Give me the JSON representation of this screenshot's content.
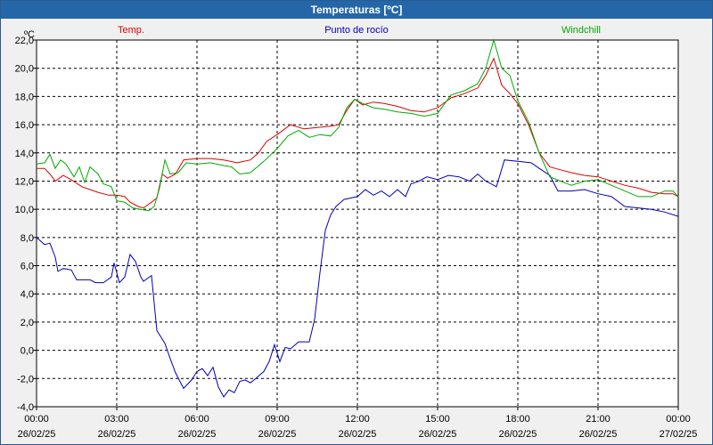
{
  "window": {
    "title": "Temperaturas [ºC]"
  },
  "chart_data": {
    "type": "line",
    "unit": "ºC",
    "ylim": [
      -4.0,
      22.0
    ],
    "ytick_step": 2,
    "ytick_labels": [
      "-4,0",
      "-2,0",
      "0,0",
      "2,0",
      "4,0",
      "6,0",
      "8,0",
      "10,0",
      "12,0",
      "14,0",
      "16,0",
      "18,0",
      "20,0",
      "22,0"
    ],
    "xlim": [
      0,
      24
    ],
    "xticks": [
      {
        "h": 0,
        "time": "00:00",
        "date": "26/02/25"
      },
      {
        "h": 3,
        "time": "03:00",
        "date": "26/02/25"
      },
      {
        "h": 6,
        "time": "06:00",
        "date": "26/02/25"
      },
      {
        "h": 9,
        "time": "09:00",
        "date": "26/02/25"
      },
      {
        "h": 12,
        "time": "12:00",
        "date": "26/02/25"
      },
      {
        "h": 15,
        "time": "15:00",
        "date": "26/02/25"
      },
      {
        "h": 18,
        "time": "18:00",
        "date": "26/02/25"
      },
      {
        "h": 21,
        "time": "21:00",
        "date": "26/02/25"
      },
      {
        "h": 24,
        "time": "00:00",
        "date": "27/02/25"
      }
    ],
    "grid": true,
    "series": [
      {
        "name": "Temp.",
        "color": "#dd0000",
        "points": [
          [
            0,
            12.9
          ],
          [
            0.3,
            12.9
          ],
          [
            0.5,
            12.5
          ],
          [
            0.7,
            12.0
          ],
          [
            1.0,
            12.4
          ],
          [
            1.3,
            12.1
          ],
          [
            1.7,
            11.6
          ],
          [
            2.0,
            11.4
          ],
          [
            2.3,
            11.2
          ],
          [
            2.7,
            11.0
          ],
          [
            3.0,
            11.0
          ],
          [
            3.3,
            10.9
          ],
          [
            3.5,
            10.5
          ],
          [
            3.8,
            10.2
          ],
          [
            4.0,
            10.1
          ],
          [
            4.3,
            10.5
          ],
          [
            4.5,
            10.8
          ],
          [
            4.7,
            12.5
          ],
          [
            4.9,
            12.2
          ],
          [
            5.2,
            12.5
          ],
          [
            5.5,
            13.5
          ],
          [
            6.0,
            13.6
          ],
          [
            6.5,
            13.6
          ],
          [
            7.0,
            13.5
          ],
          [
            7.5,
            13.3
          ],
          [
            8.0,
            13.5
          ],
          [
            8.3,
            14.0
          ],
          [
            8.6,
            14.8
          ],
          [
            9.0,
            15.3
          ],
          [
            9.5,
            16.0
          ],
          [
            10.0,
            15.7
          ],
          [
            10.5,
            15.8
          ],
          [
            11.0,
            15.9
          ],
          [
            11.3,
            16.0
          ],
          [
            11.6,
            17.0
          ],
          [
            11.9,
            17.8
          ],
          [
            12.2,
            17.4
          ],
          [
            12.6,
            17.6
          ],
          [
            13.0,
            17.5
          ],
          [
            13.5,
            17.3
          ],
          [
            14.0,
            17.0
          ],
          [
            14.5,
            16.9
          ],
          [
            15.0,
            17.2
          ],
          [
            15.5,
            17.9
          ],
          [
            16.0,
            18.2
          ],
          [
            16.5,
            18.6
          ],
          [
            16.8,
            19.5
          ],
          [
            17.1,
            20.7
          ],
          [
            17.4,
            18.8
          ],
          [
            17.7,
            18.2
          ],
          [
            18.0,
            17.5
          ],
          [
            18.4,
            16.0
          ],
          [
            18.8,
            14.0
          ],
          [
            19.2,
            13.0
          ],
          [
            19.6,
            12.8
          ],
          [
            20.0,
            12.6
          ],
          [
            20.5,
            12.4
          ],
          [
            21.0,
            12.3
          ],
          [
            21.5,
            12.0
          ],
          [
            22.0,
            11.7
          ],
          [
            22.5,
            11.5
          ],
          [
            23.0,
            11.2
          ],
          [
            23.5,
            11.1
          ],
          [
            23.8,
            11.1
          ],
          [
            24.0,
            10.9
          ]
        ]
      },
      {
        "name": "Punto de rocío",
        "color": "#0000bb",
        "points": [
          [
            0,
            8.0
          ],
          [
            0.3,
            7.5
          ],
          [
            0.5,
            7.6
          ],
          [
            0.7,
            6.6
          ],
          [
            0.8,
            5.6
          ],
          [
            1.0,
            5.8
          ],
          [
            1.3,
            5.7
          ],
          [
            1.5,
            5.0
          ],
          [
            2.0,
            5.0
          ],
          [
            2.2,
            4.8
          ],
          [
            2.5,
            4.8
          ],
          [
            2.8,
            5.2
          ],
          [
            2.9,
            6.2
          ],
          [
            3.1,
            4.8
          ],
          [
            3.3,
            5.2
          ],
          [
            3.5,
            6.8
          ],
          [
            3.7,
            6.3
          ],
          [
            3.9,
            5.2
          ],
          [
            4.0,
            4.9
          ],
          [
            4.3,
            5.3
          ],
          [
            4.5,
            1.4
          ],
          [
            4.8,
            0.5
          ],
          [
            5.0,
            -0.6
          ],
          [
            5.2,
            -1.6
          ],
          [
            5.5,
            -2.7
          ],
          [
            5.8,
            -2.1
          ],
          [
            6.0,
            -1.5
          ],
          [
            6.2,
            -1.3
          ],
          [
            6.4,
            -1.8
          ],
          [
            6.6,
            -1.2
          ],
          [
            6.8,
            -2.6
          ],
          [
            7.0,
            -3.3
          ],
          [
            7.2,
            -2.8
          ],
          [
            7.4,
            -3.0
          ],
          [
            7.6,
            -2.2
          ],
          [
            7.8,
            -2.1
          ],
          [
            8.0,
            -2.3
          ],
          [
            8.2,
            -2.0
          ],
          [
            8.5,
            -1.5
          ],
          [
            8.7,
            -0.8
          ],
          [
            8.9,
            0.4
          ],
          [
            9.1,
            -0.8
          ],
          [
            9.3,
            0.2
          ],
          [
            9.5,
            0.1
          ],
          [
            9.8,
            0.6
          ],
          [
            10.0,
            0.6
          ],
          [
            10.2,
            0.6
          ],
          [
            10.4,
            2.2
          ],
          [
            10.6,
            5.5
          ],
          [
            10.8,
            8.5
          ],
          [
            11.0,
            9.6
          ],
          [
            11.2,
            10.2
          ],
          [
            11.5,
            10.7
          ],
          [
            12.0,
            10.9
          ],
          [
            12.3,
            11.4
          ],
          [
            12.6,
            11.0
          ],
          [
            12.9,
            11.3
          ],
          [
            13.2,
            10.9
          ],
          [
            13.5,
            11.4
          ],
          [
            13.8,
            10.9
          ],
          [
            14.0,
            11.8
          ],
          [
            14.3,
            12.0
          ],
          [
            14.6,
            12.3
          ],
          [
            15.0,
            12.1
          ],
          [
            15.4,
            12.4
          ],
          [
            15.8,
            12.3
          ],
          [
            16.2,
            12.0
          ],
          [
            16.5,
            12.5
          ],
          [
            16.8,
            12.0
          ],
          [
            17.0,
            11.8
          ],
          [
            17.2,
            11.6
          ],
          [
            17.5,
            13.5
          ],
          [
            18.0,
            13.4
          ],
          [
            18.5,
            13.3
          ],
          [
            18.8,
            12.9
          ],
          [
            19.2,
            12.4
          ],
          [
            19.5,
            11.3
          ],
          [
            20.0,
            11.3
          ],
          [
            20.5,
            11.4
          ],
          [
            21.0,
            11.1
          ],
          [
            21.5,
            10.9
          ],
          [
            22.0,
            10.2
          ],
          [
            22.5,
            10.1
          ],
          [
            23.0,
            10.0
          ],
          [
            23.5,
            9.8
          ],
          [
            24.0,
            9.5
          ]
        ]
      },
      {
        "name": "Windchill",
        "color": "#00aa00",
        "points": [
          [
            0,
            13.2
          ],
          [
            0.3,
            13.3
          ],
          [
            0.5,
            13.9
          ],
          [
            0.7,
            12.9
          ],
          [
            0.9,
            13.5
          ],
          [
            1.1,
            13.2
          ],
          [
            1.4,
            12.3
          ],
          [
            1.6,
            13.0
          ],
          [
            1.8,
            11.9
          ],
          [
            2.0,
            13.0
          ],
          [
            2.3,
            12.5
          ],
          [
            2.5,
            11.8
          ],
          [
            2.8,
            11.6
          ],
          [
            3.0,
            10.6
          ],
          [
            3.3,
            10.5
          ],
          [
            3.6,
            10.1
          ],
          [
            3.9,
            10.0
          ],
          [
            4.2,
            9.9
          ],
          [
            4.4,
            10.2
          ],
          [
            4.6,
            11.5
          ],
          [
            4.8,
            13.5
          ],
          [
            5.0,
            12.5
          ],
          [
            5.3,
            12.6
          ],
          [
            5.6,
            13.3
          ],
          [
            6.0,
            13.2
          ],
          [
            6.5,
            13.3
          ],
          [
            7.0,
            13.1
          ],
          [
            7.3,
            13.0
          ],
          [
            7.6,
            12.5
          ],
          [
            8.0,
            12.6
          ],
          [
            8.5,
            13.4
          ],
          [
            9.0,
            14.3
          ],
          [
            9.4,
            15.2
          ],
          [
            9.8,
            15.6
          ],
          [
            10.2,
            15.1
          ],
          [
            10.6,
            15.3
          ],
          [
            11.0,
            15.2
          ],
          [
            11.3,
            15.8
          ],
          [
            11.6,
            17.2
          ],
          [
            11.9,
            17.8
          ],
          [
            12.2,
            17.5
          ],
          [
            12.6,
            17.2
          ],
          [
            13.0,
            17.1
          ],
          [
            13.5,
            16.9
          ],
          [
            14.0,
            16.8
          ],
          [
            14.5,
            16.6
          ],
          [
            15.0,
            16.8
          ],
          [
            15.5,
            18.1
          ],
          [
            16.0,
            18.4
          ],
          [
            16.5,
            18.9
          ],
          [
            16.8,
            20.0
          ],
          [
            17.1,
            22.0
          ],
          [
            17.4,
            20.0
          ],
          [
            17.7,
            19.5
          ],
          [
            18.0,
            17.7
          ],
          [
            18.4,
            16.2
          ],
          [
            18.8,
            14.0
          ],
          [
            19.2,
            12.3
          ],
          [
            19.6,
            12.0
          ],
          [
            20.0,
            11.7
          ],
          [
            20.5,
            12.0
          ],
          [
            21.0,
            12.1
          ],
          [
            21.5,
            11.7
          ],
          [
            22.0,
            11.3
          ],
          [
            22.5,
            10.9
          ],
          [
            23.0,
            10.9
          ],
          [
            23.5,
            11.3
          ],
          [
            23.8,
            11.3
          ],
          [
            24.0,
            10.9
          ]
        ]
      }
    ]
  }
}
